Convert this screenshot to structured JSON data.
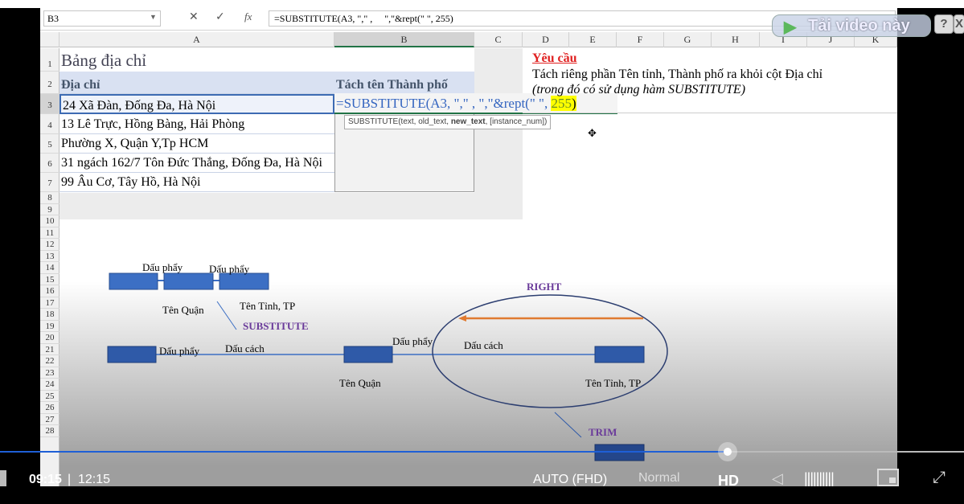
{
  "formula_bar": {
    "name_box": "B3",
    "cancel": "✕",
    "enter": "✓",
    "fx": "fx",
    "formula": "=SUBSTITUTE(A3, \",\" ,     \",\"&rept(\" \", 255)"
  },
  "columns": [
    "A",
    "B",
    "C",
    "D",
    "E",
    "F",
    "G",
    "H",
    "I",
    "J",
    "K"
  ],
  "rows": [
    "1",
    "2",
    "3",
    "4",
    "5",
    "6",
    "7",
    "8",
    "9",
    "10",
    "11",
    "12",
    "13",
    "14",
    "15",
    "16",
    "17",
    "18",
    "19",
    "20",
    "21",
    "22",
    "23",
    "24",
    "25",
    "26",
    "27",
    "28"
  ],
  "sheet": {
    "title": "Bảng địa chỉ",
    "header_a": "Địa chỉ",
    "header_b": "Tách tên Thành phố",
    "addresses": [
      "24 Xã Đàn, Đống Đa, Hà Nội",
      "13 Lê Trực, Hồng Bàng, Hải Phòng",
      "Phường X, Quận Y,Tp HCM",
      "31 ngách 162/7 Tôn Đức Thắng, Đống Đa, Hà Nội",
      "99 Âu Cơ, Tây Hồ,  Hà Nội"
    ],
    "b3_editing_prefix": "=SUBSTITUTE(A3, \",\" ,     \",\"&rept(\" \", ",
    "b3_editing_num": "255",
    "b3_editing_suffix": ")",
    "tooltip_pre": "SUBSTITUTE(text, old_text, ",
    "tooltip_bold": "new_text",
    "tooltip_post": ", [instance_num])"
  },
  "requirement": {
    "title": "Yêu cầu",
    "line1": "Tách riêng phần Tên tỉnh, Thành phố ra khỏi cột Địa chỉ",
    "line2": "(trong đó có sử dụng hàm SUBSTITUTE)"
  },
  "diagram": {
    "comma1": "Dấu phẩy",
    "comma2": "Dấu phẩy",
    "quan_top": "Tên Quận",
    "tinh_top": "Tên Tỉnh, TP",
    "substitute": "SUBSTITUTE",
    "right": "RIGHT",
    "trim": "TRIM",
    "comma3": "Dấu phẩy",
    "space1": "Dấu cách",
    "comma4": "Dấu phẩy",
    "space2": "Dấu cách",
    "quan_bottom": "Tên Quận",
    "tinh_bottom": "Tên Tỉnh, TP",
    "colors": {
      "box": "#3c6fc4",
      "label_purple": "#6a3a9a",
      "arrow_orange": "#e07a30",
      "ellipse": "#2c3e70"
    }
  },
  "overlay": {
    "download": "Tải video này",
    "help": "?",
    "close": "X"
  },
  "player": {
    "current_time": "09:15",
    "duration": "12:15",
    "quality": "AUTO (FHD)",
    "speed": "Normal",
    "hd": "HD",
    "progress": 0.755,
    "accent": "#1e5fd6"
  }
}
